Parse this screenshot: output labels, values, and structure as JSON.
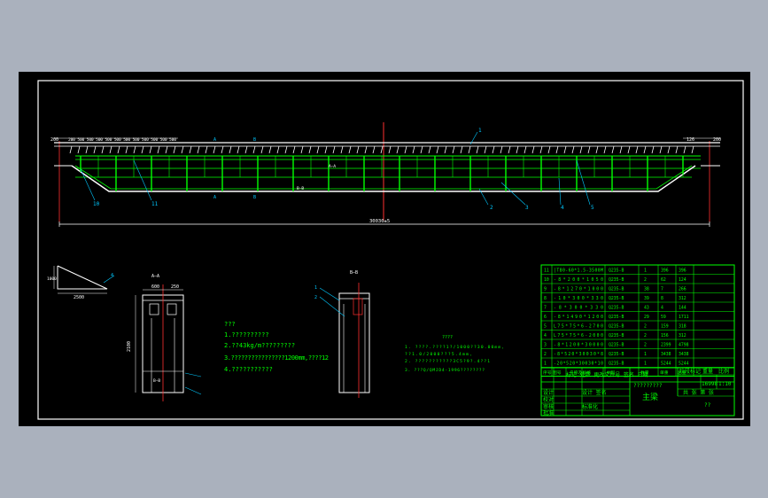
{
  "dims": {
    "top_segments": "200 500 500 500 500 500 500 500 500 500 500 500",
    "top_left_end": "200",
    "top_right_segments": "126",
    "top_right_end": "200",
    "overall_length": "30030±5",
    "side_label": "2500",
    "side_height": "1000",
    "side_tag": "4",
    "section_width_1": "600",
    "section_width_2": "250",
    "section_height": "2100",
    "section_aa": "A—A",
    "section_bb": "B—B",
    "right_section_label": "B—B",
    "right_section_tags": [
      "1",
      "2"
    ],
    "inner_label_1": "A—A",
    "inner_label_2": "B—B"
  },
  "callouts": {
    "left_bottom": [
      "10",
      "11"
    ],
    "right_bottom": [
      "2",
      "3",
      "4",
      "5"
    ],
    "top_right": "1",
    "mid_tag": "A",
    "mid_tag_b": "B"
  },
  "notes_left": {
    "title": "???",
    "lines": [
      "1.??????????",
      "2.??43kg/m?????????",
      "3.????????????????1200mm,????12",
      "4.???????????"
    ]
  },
  "notes_right": {
    "title": "????",
    "lines": [
      "1. ????.????1?/1000??30.00mm,",
      "   ??1.0/2000???5.4mm,",
      "2. ???????????3C5?9?.4??1",
      "3. ???Q/QMJD4-1996????????"
    ]
  },
  "bom": {
    "rows": [
      [
        "11",
        "[T80-60*1.5-3500M",
        "Q235-B",
        "1",
        "396",
        "396"
      ],
      [
        "10",
        "-8*200*1050",
        "Q235-B",
        "2",
        "62",
        "124"
      ],
      [
        "9",
        "-8*1270*1000",
        "Q235-B",
        "38",
        "7",
        "266"
      ],
      [
        "8",
        "-10*300*330",
        "Q235-B",
        "39",
        "8",
        "312"
      ],
      [
        "7",
        "-8*300*330",
        "Q235-B",
        "43",
        "4",
        "144"
      ],
      [
        "6",
        "-8*1490*1200",
        "Q235-B",
        "29",
        "59",
        "1711"
      ],
      [
        "5",
        "L75*75*6-2700",
        "Q235-B",
        "2",
        "159",
        "318"
      ],
      [
        "4",
        "L75*75*6-2000",
        "Q235-B",
        "2",
        "156",
        "312"
      ],
      [
        "3",
        "-8*1200*30000",
        "Q235-B",
        "2",
        "2399",
        "4798"
      ],
      [
        "2",
        "-8*520*30030*8",
        "Q235-B",
        "1",
        "3438",
        "3438"
      ],
      [
        "1",
        "-20*520*30030*10",
        "Q235-B",
        "1",
        "5244",
        "5244"
      ]
    ],
    "header_row": [
      "序号",
      "图号",
      "名称及规格",
      "材料",
      "数量",
      "单重",
      "总重"
    ],
    "title_block": {
      "label_a": "设计",
      "label_b": "校对",
      "label_c": "审核",
      "part_name": "主梁",
      "stage": "阶段标记",
      "weight": "重量",
      "scale": "比例",
      "weight_val": "16998",
      "scale_val": "1:10",
      "sheet": "共  张 第  张",
      "question": "?????????",
      "row2": "标记 处数 更改文件号 签名 日期",
      "designer_row": "设计  签名",
      "std_row": "标准化",
      "ok": "批准",
      "tail": "??"
    }
  }
}
